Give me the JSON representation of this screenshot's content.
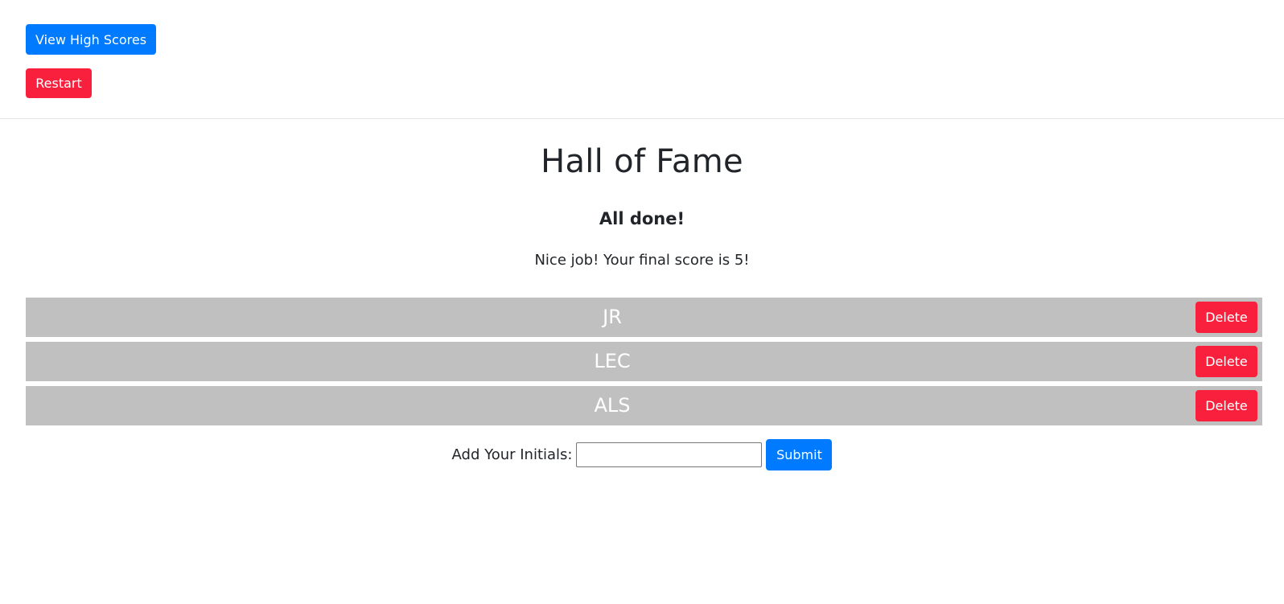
{
  "header": {
    "view_high_scores_label": "View High Scores",
    "restart_label": "Restart"
  },
  "main": {
    "title": "Hall of Fame",
    "subtitle": "All done!",
    "score_message": "Nice job! Your final score is 5!"
  },
  "scores": [
    {
      "name": "JR",
      "delete_label": "Delete"
    },
    {
      "name": "LEC",
      "delete_label": "Delete"
    },
    {
      "name": "ALS",
      "delete_label": "Delete"
    }
  ],
  "form": {
    "label": "Add Your Initials:",
    "input_value": "",
    "submit_label": "Submit"
  },
  "colors": {
    "primary": "#007bff",
    "danger": "#f8203c",
    "row_background": "#c0c0c0"
  }
}
